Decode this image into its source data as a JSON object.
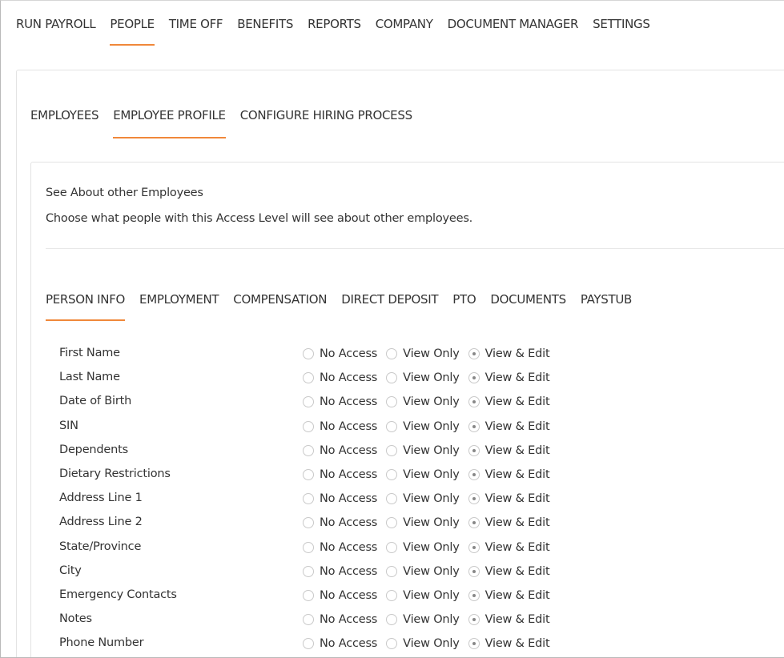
{
  "top_nav": [
    {
      "label": "RUN PAYROLL",
      "active": false
    },
    {
      "label": "PEOPLE",
      "active": true
    },
    {
      "label": "TIME OFF",
      "active": false
    },
    {
      "label": "BENEFITS",
      "active": false
    },
    {
      "label": "REPORTS",
      "active": false
    },
    {
      "label": "COMPANY",
      "active": false
    },
    {
      "label": "DOCUMENT MANAGER",
      "active": false
    },
    {
      "label": "SETTINGS",
      "active": false
    }
  ],
  "sub_nav": [
    {
      "label": "EMPLOYEES",
      "active": false
    },
    {
      "label": "EMPLOYEE PROFILE",
      "active": true
    },
    {
      "label": "CONFIGURE HIRING PROCESS",
      "active": false
    }
  ],
  "section": {
    "title": "See About other Employees",
    "description": "Choose what people with this Access Level will see about other employees."
  },
  "category_tabs": [
    {
      "label": "PERSON INFO",
      "active": true
    },
    {
      "label": "EMPLOYMENT",
      "active": false
    },
    {
      "label": "COMPENSATION",
      "active": false
    },
    {
      "label": "DIRECT DEPOSIT",
      "active": false
    },
    {
      "label": "PTO",
      "active": false
    },
    {
      "label": "DOCUMENTS",
      "active": false
    },
    {
      "label": "PAYSTUB",
      "active": false
    }
  ],
  "options": [
    "No Access",
    "View Only",
    "View & Edit"
  ],
  "fields": [
    {
      "label": "First Name",
      "selected": "View & Edit"
    },
    {
      "label": "Last Name",
      "selected": "View & Edit"
    },
    {
      "label": "Date of Birth",
      "selected": "View & Edit"
    },
    {
      "label": "SIN",
      "selected": "View & Edit"
    },
    {
      "label": "Dependents",
      "selected": "View & Edit"
    },
    {
      "label": "Dietary Restrictions",
      "selected": "View & Edit"
    },
    {
      "label": "Address Line 1",
      "selected": "View & Edit"
    },
    {
      "label": "Address Line 2",
      "selected": "View & Edit"
    },
    {
      "label": "State/Province",
      "selected": "View & Edit"
    },
    {
      "label": "City",
      "selected": "View & Edit"
    },
    {
      "label": "Emergency Contacts",
      "selected": "View & Edit"
    },
    {
      "label": "Notes",
      "selected": "View & Edit"
    },
    {
      "label": "Phone Number",
      "selected": "View & Edit"
    }
  ],
  "colors": {
    "accent": "#f0883a",
    "border": "#e3e3e3"
  }
}
